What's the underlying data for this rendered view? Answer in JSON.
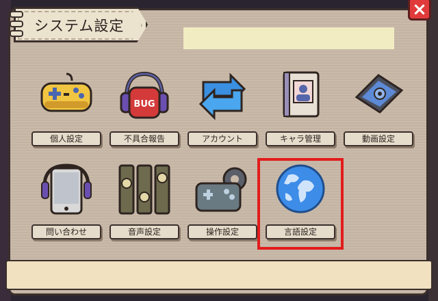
{
  "dialog": {
    "title": "システム設定",
    "close_label": "×",
    "items": [
      {
        "label": "個人設定",
        "icon": "gamepad-icon"
      },
      {
        "label": "不具合報告",
        "icon": "bug-report-icon"
      },
      {
        "label": "アカウント",
        "icon": "account-sync-icon"
      },
      {
        "label": "キャラ管理",
        "icon": "character-book-icon"
      },
      {
        "label": "動画設定",
        "icon": "video-tablet-icon"
      },
      {
        "label": "問い合わせ",
        "icon": "contact-phone-icon"
      },
      {
        "label": "音声設定",
        "icon": "audio-sliders-icon"
      },
      {
        "label": "操作設定",
        "icon": "controls-gear-icon"
      },
      {
        "label": "言語設定",
        "icon": "globe-icon"
      }
    ],
    "selected_item": "言語設定",
    "colors": {
      "panel": "#c9b9a8",
      "highlight": "#e21c1c",
      "label_bg": "#e6dccb",
      "input_bar": "#f1ecc2"
    }
  }
}
